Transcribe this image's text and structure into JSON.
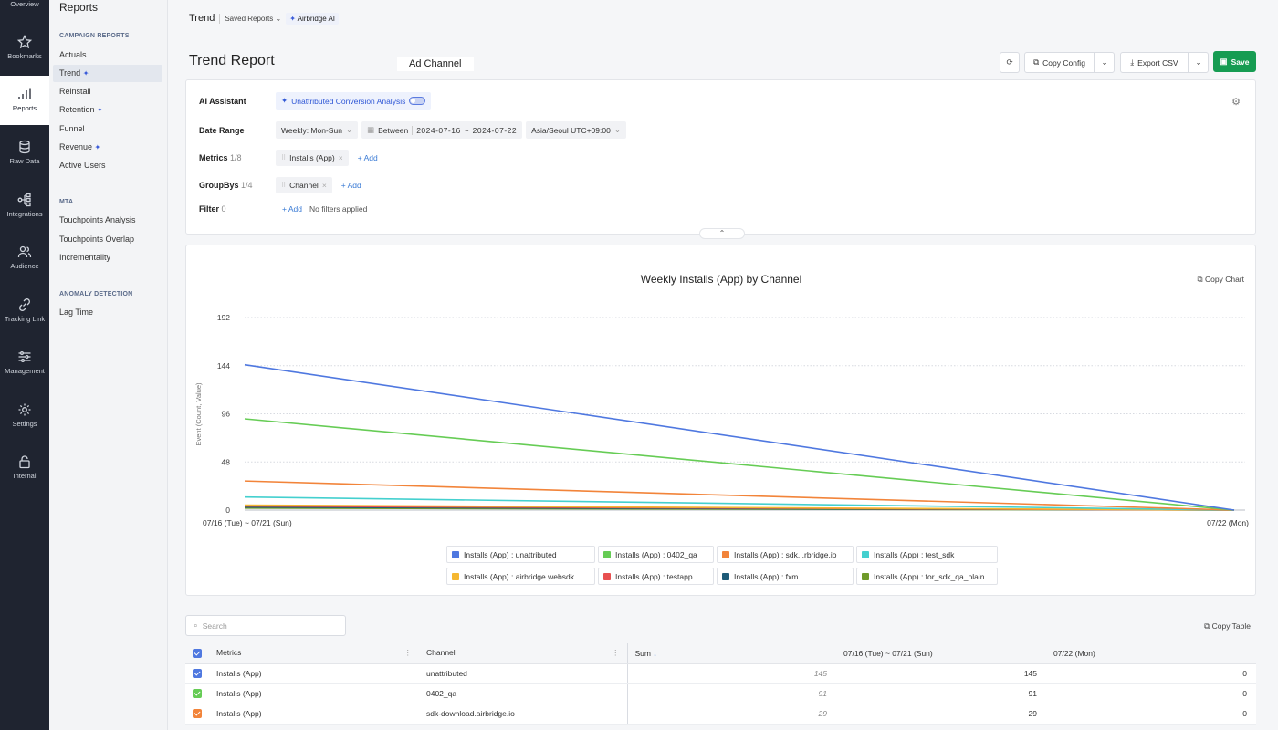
{
  "rail": {
    "items": [
      {
        "label": "Overview"
      },
      {
        "label": "Bookmarks"
      },
      {
        "label": "Reports"
      },
      {
        "label": "Raw Data"
      },
      {
        "label": "Integrations"
      },
      {
        "label": "Audience"
      },
      {
        "label": "Tracking Link"
      },
      {
        "label": "Management"
      },
      {
        "label": "Settings"
      },
      {
        "label": "Internal"
      }
    ]
  },
  "subnav": {
    "title": "Reports",
    "sections": [
      "CAMPAIGN REPORTS",
      "MTA",
      "ANOMALY DETECTION"
    ],
    "items": [
      "Actuals",
      "Trend",
      "Reinstall",
      "Retention",
      "Funnel",
      "Revenue",
      "Active Users",
      "Touchpoints Analysis",
      "Touchpoints Overlap",
      "Incrementality",
      "Lag Time"
    ]
  },
  "topbar": {
    "crumb": "Trend",
    "saved_reports": "Saved Reports",
    "ai": "Airbridge AI"
  },
  "page": {
    "title": "Trend Report",
    "tooltip": "Ad Channel"
  },
  "actions": {
    "copy_config": "Copy Config",
    "export_csv": "Export CSV",
    "save": "Save"
  },
  "config": {
    "ai_label": "AI Assistant",
    "ai_feature": "Unattributed Conversion Analysis",
    "date_label": "Date Range",
    "date_granularity": "Weekly: Mon-Sun",
    "between": "Between",
    "date_start": "2024-07-16",
    "date_end": "2024-07-22",
    "date_dash": "~",
    "timezone": "Asia/Seoul UTC+09:00",
    "metrics_label": "Metrics",
    "metrics_count": "1/8",
    "metric_chip": "Installs (App)",
    "groupbys_label": "GroupBys",
    "groupbys_count": "1/4",
    "groupby_chip": "Channel",
    "filter_label": "Filter",
    "filter_count": "0",
    "add": "+ Add",
    "no_filters": "No filters applied"
  },
  "chart_panel": {
    "copy_chart": "Copy Chart"
  },
  "chart_data": {
    "type": "line",
    "title": "Weekly Installs (App) by Channel",
    "ylabel": "Event (Count, Value)",
    "xlabel": "",
    "categories": [
      "07/16 (Tue) ~ 07/21 (Sun)",
      "07/22 (Mon)"
    ],
    "yticks": [
      0,
      48,
      96,
      144,
      192
    ],
    "ylim": [
      0,
      192
    ],
    "grid": true,
    "legend_position": "bottom",
    "series": [
      {
        "name": "Installs (App) : unattributed",
        "color": "#4f78e0",
        "values": [
          145,
          0
        ]
      },
      {
        "name": "Installs (App) : 0402_qa",
        "color": "#66cc55",
        "values": [
          91,
          0
        ]
      },
      {
        "name": "Installs (App) : sdk...rbridge.io",
        "color": "#f2843a",
        "values": [
          29,
          0
        ]
      },
      {
        "name": "Installs (App) : test_sdk",
        "color": "#44d0cf",
        "values": [
          13,
          0
        ]
      },
      {
        "name": "Installs (App) : airbridge.websdk",
        "color": "#f5b731",
        "values": [
          5,
          0
        ]
      },
      {
        "name": "Installs (App) : testapp",
        "color": "#e85050",
        "values": [
          4,
          0
        ]
      },
      {
        "name": "Installs (App) : fxm",
        "color": "#1e5b78",
        "values": [
          3,
          0
        ]
      },
      {
        "name": "Installs (App) : for_sdk_qa_plain",
        "color": "#6f9a2a",
        "values": [
          2,
          0
        ]
      }
    ]
  },
  "table": {
    "search_placeholder": "Search",
    "copy_table": "Copy Table",
    "headers": [
      "Metrics",
      "Channel",
      "Sum",
      "07/16 (Tue) ~ 07/21 (Sun)",
      "07/22 (Mon)"
    ],
    "rows": [
      {
        "metric": "Installs (App)",
        "channel": "unattributed",
        "sum": "145",
        "w1": "145",
        "w2": "0",
        "color": "#4f78e0"
      },
      {
        "metric": "Installs (App)",
        "channel": "0402_qa",
        "sum": "91",
        "w1": "91",
        "w2": "0",
        "color": "#66cc55"
      },
      {
        "metric": "Installs (App)",
        "channel": "sdk-download.airbridge.io",
        "sum": "29",
        "w1": "29",
        "w2": "0",
        "color": "#f2843a"
      }
    ]
  }
}
